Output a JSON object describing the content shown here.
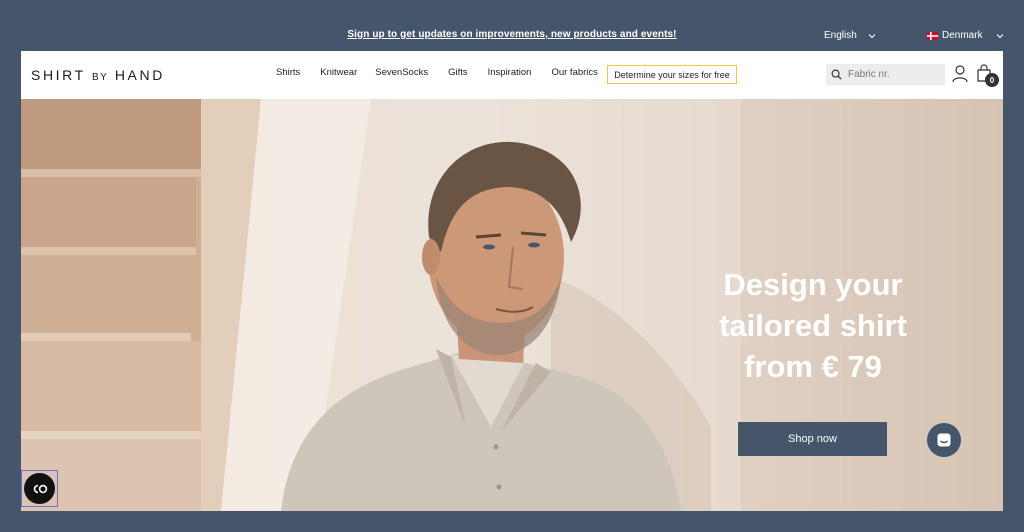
{
  "topbar": {
    "signup_text": "Sign up to get updates on improvements, new products and events!",
    "language": "English",
    "country": "Denmark"
  },
  "nav": {
    "logo_main": "SHIRT",
    "logo_by": "BY",
    "logo_end": "HAND",
    "items": [
      "Shirts",
      "Knitwear",
      "SevenSocks",
      "Gifts",
      "Inspiration",
      "Our fabrics"
    ],
    "sizes_button": "Determine your sizes for free",
    "search_placeholder": "Fabric nr.",
    "cart_count": "0"
  },
  "hero": {
    "headline_1": "Design your",
    "headline_2": "tailored shirt",
    "headline_3": "from € 79",
    "cta": "Shop now"
  },
  "colors": {
    "brand": "#45566b",
    "highlight": "#e7c84a"
  }
}
